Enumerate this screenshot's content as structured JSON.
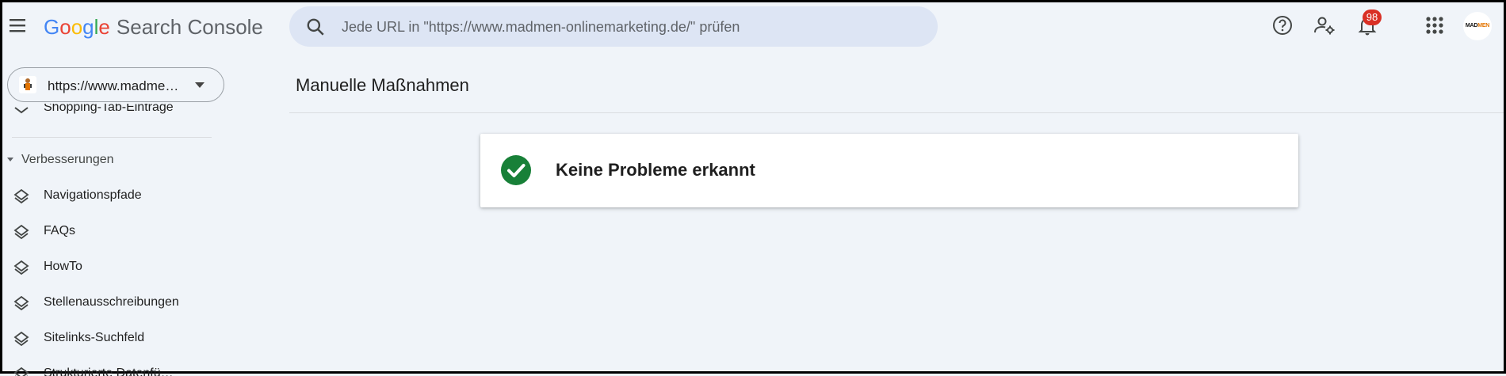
{
  "header": {
    "logo_letters": [
      "G",
      "o",
      "o",
      "g",
      "l",
      "e"
    ],
    "product_name": "Search Console",
    "search_placeholder": "Jede URL in \"https://www.madmen-onlinemarketing.de/\" prüfen",
    "icons": [
      "menu-icon",
      "search-icon",
      "help-icon",
      "manage-users-icon",
      "notifications-icon",
      "apps-icon"
    ],
    "notification_count": "98",
    "avatar": {
      "part1": "MAD",
      "part2": "MEN"
    }
  },
  "sidebar": {
    "property_label": "https://www.madme…",
    "cut_item": "Shopping-Tab-Einträge",
    "section_title": "Verbesserungen",
    "items": [
      {
        "label": "Navigationspfade"
      },
      {
        "label": "FAQs"
      },
      {
        "label": "HowTo"
      },
      {
        "label": "Stellenausschreibungen"
      },
      {
        "label": "Sitelinks-Suchfeld"
      },
      {
        "label": "Strukturierte Datenfü…"
      }
    ]
  },
  "main": {
    "page_title": "Manuelle Maßnahmen",
    "status_card": {
      "text": "Keine Probleme erkannt",
      "icon": "check-circle-icon",
      "icon_color": "#188038"
    }
  },
  "colors": {
    "background": "#f0f4f9",
    "search_bg": "#dde5f4",
    "badge": "#d93025"
  }
}
